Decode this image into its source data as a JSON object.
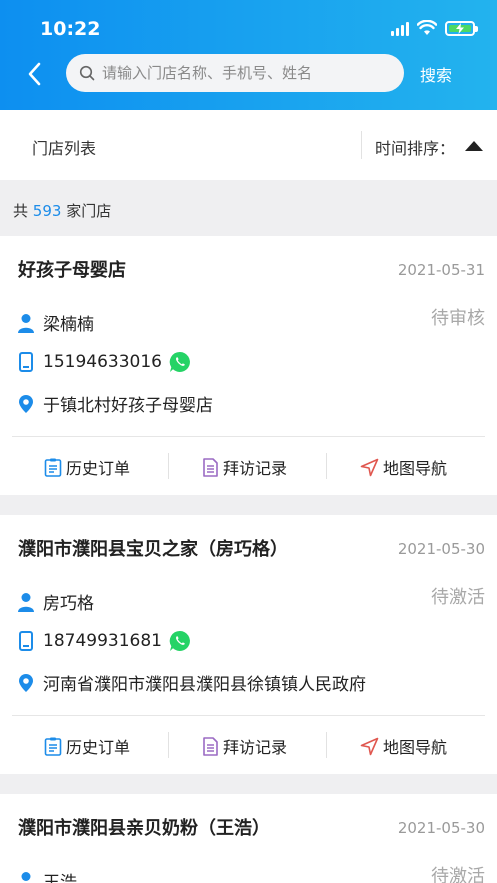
{
  "status_bar": {
    "time": "10:22"
  },
  "search": {
    "placeholder": "请输入门店名称、手机号、姓名",
    "value": "",
    "button_label": "搜索"
  },
  "filter": {
    "title": "门店列表",
    "sort_label": "时间排序："
  },
  "summary": {
    "prefix": "共",
    "count": "593",
    "suffix": "家门店"
  },
  "actions": {
    "history": "历史订单",
    "visits": "拜访记录",
    "map": "地图导航"
  },
  "colors": {
    "header_start": "#0d8ff0",
    "header_end": "#23b3ee",
    "accent": "#1c8ce9",
    "whatsapp": "#25d366"
  },
  "stores": [
    {
      "name": "好孩子母婴店",
      "date": "2021-05-31",
      "status": "待审核",
      "contact": "梁楠楠",
      "phone": "15194633016",
      "address": "于镇北村好孩子母婴店"
    },
    {
      "name": "濮阳市濮阳县宝贝之家（房巧格）",
      "date": "2021-05-30",
      "status": "待激活",
      "contact": "房巧格",
      "phone": "18749931681",
      "address": "河南省濮阳市濮阳县濮阳县徐镇镇人民政府"
    },
    {
      "name": "濮阳市濮阳县亲贝奶粉（王浩）",
      "date": "2021-05-30",
      "status": "待激活",
      "contact": "王浩",
      "phone": "",
      "address": ""
    }
  ]
}
